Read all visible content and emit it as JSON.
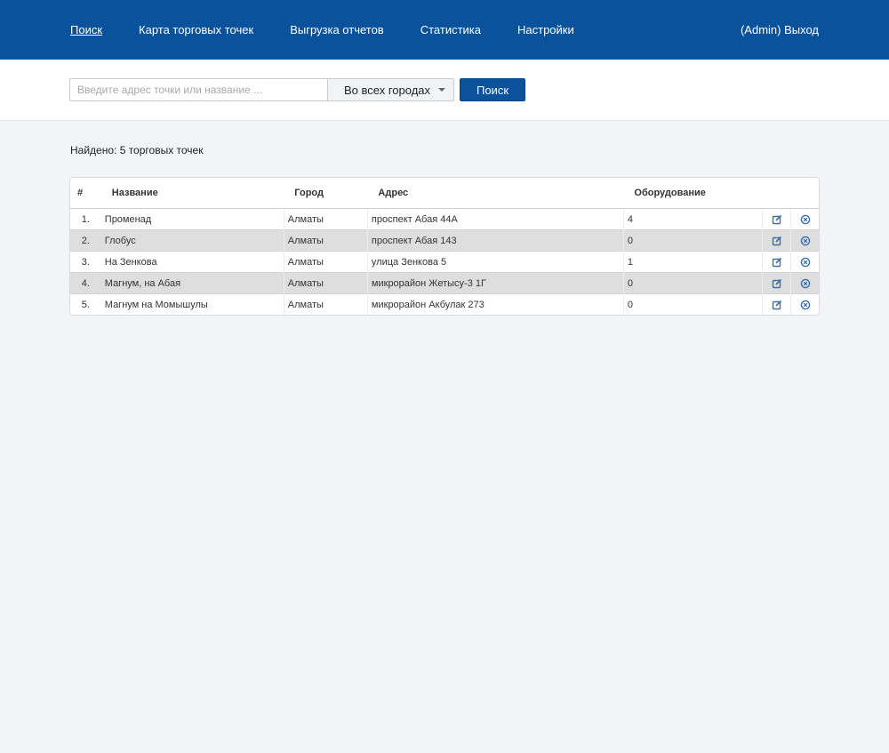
{
  "nav": {
    "items": [
      {
        "label": "Поиск",
        "active": true
      },
      {
        "label": "Карта торговых точек",
        "active": false
      },
      {
        "label": "Выгрузка отчетов",
        "active": false
      },
      {
        "label": "Статистика",
        "active": false
      },
      {
        "label": "Настройки",
        "active": false
      }
    ],
    "logout_label": "(Admin) Выход"
  },
  "search": {
    "placeholder": "Введите адрес точки или название ...",
    "value": "",
    "city_selected": "Во всех городах",
    "button_label": "Поиск"
  },
  "results": {
    "found_text": "Найдено: 5 торговых точек",
    "columns": [
      "#",
      "Название",
      "Город",
      "Адрес",
      "Оборудование"
    ],
    "rows": [
      {
        "num": "1.",
        "name": "Променад",
        "city": "Алматы",
        "address": "проспект Абая 44А",
        "equipment": "4"
      },
      {
        "num": "2.",
        "name": "Глобус",
        "city": "Алматы",
        "address": "проспект Абая 143",
        "equipment": "0"
      },
      {
        "num": "3.",
        "name": "На Зенкова",
        "city": "Алматы",
        "address": "улица Зенкова 5",
        "equipment": "1"
      },
      {
        "num": "4.",
        "name": "Магнум, на Абая",
        "city": "Алматы",
        "address": "микрорайон Жетысу-3 1Г",
        "equipment": "0"
      },
      {
        "num": "5.",
        "name": "Магнум на Момышулы",
        "city": "Алматы",
        "address": "микрорайон Акбулак 273",
        "equipment": "0"
      }
    ]
  },
  "icons": {
    "edit": "edit-icon",
    "delete": "delete-circle-icon",
    "dropdown": "chevron-down-icon"
  },
  "colors": {
    "brand": "#0a529b",
    "icon": "#3a6fa8",
    "row_alt": "#dedede"
  }
}
